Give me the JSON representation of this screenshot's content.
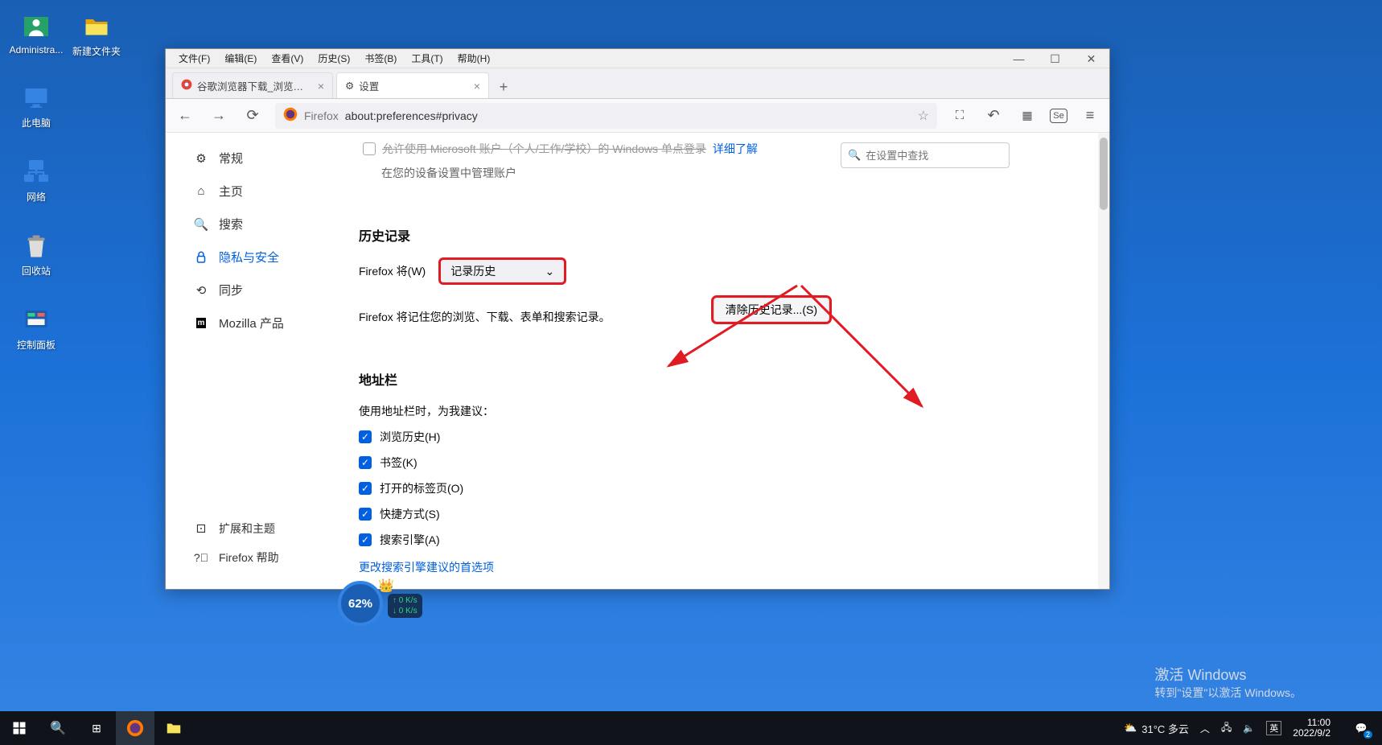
{
  "desktop": {
    "icons_col1": [
      {
        "name": "administrator",
        "label": "Administra..."
      },
      {
        "name": "this-pc",
        "label": "此电脑"
      },
      {
        "name": "network",
        "label": "网络"
      },
      {
        "name": "recycle-bin",
        "label": "回收站"
      },
      {
        "name": "control-panel",
        "label": "控制面板"
      }
    ],
    "icons_col2": [
      {
        "name": "new-folder",
        "label": "新建文件夹"
      }
    ]
  },
  "firefox": {
    "menubar": [
      "文件(F)",
      "编辑(E)",
      "查看(V)",
      "历史(S)",
      "书签(B)",
      "工具(T)",
      "帮助(H)"
    ],
    "tabs": [
      {
        "label": "谷歌浏览器下载_浏览器官网入口",
        "active": false,
        "icon": "chrome"
      },
      {
        "label": "设置",
        "active": true,
        "icon": "gear"
      }
    ],
    "url": {
      "brand": "Firefox",
      "address": "about:preferences#privacy"
    },
    "sidebar": {
      "items": [
        {
          "icon": "gear",
          "label": "常规"
        },
        {
          "icon": "home",
          "label": "主页"
        },
        {
          "icon": "search",
          "label": "搜索"
        },
        {
          "icon": "lock",
          "label": "隐私与安全",
          "active": true
        },
        {
          "icon": "sync",
          "label": "同步"
        },
        {
          "icon": "mozilla",
          "label": "Mozilla 产品"
        }
      ],
      "bottom": [
        {
          "icon": "puzzle",
          "label": "扩展和主题"
        },
        {
          "icon": "help",
          "label": "Firefox 帮助"
        }
      ]
    },
    "search_placeholder": "在设置中查找",
    "truncated_row_text": "允许使用 Microsoft 账户（个人/工作/学校）的 Windows 单点登录",
    "truncated_link": "详细了解",
    "sub_note": "在您的设备设置中管理账户",
    "history": {
      "title": "历史记录",
      "firefox_will_label": "Firefox 将(W)",
      "select_value": "记录历史",
      "desc": "Firefox 将记住您的浏览、下载、表单和搜索记录。",
      "clear_button": "清除历史记录...(S)"
    },
    "addressbar": {
      "title": "地址栏",
      "subtitle": "使用地址栏时，为我建议：",
      "checks": [
        "浏览历史(H)",
        "书签(K)",
        "打开的标签页(O)",
        "快捷方式(S)",
        "搜索引擎(A)"
      ],
      "link": "更改搜索引擎建议的首选项"
    }
  },
  "widget": {
    "percent": "62%",
    "up": "0 K/s",
    "down": "0 K/s"
  },
  "watermark": {
    "line1": "激活 Windows",
    "line2": "转到\"设置\"以激活 Windows。"
  },
  "taskbar": {
    "weather": "31°C  多云",
    "ime": "英",
    "clock_time": "11:00",
    "clock_date": "2022/9/2",
    "notif_count": "2"
  }
}
